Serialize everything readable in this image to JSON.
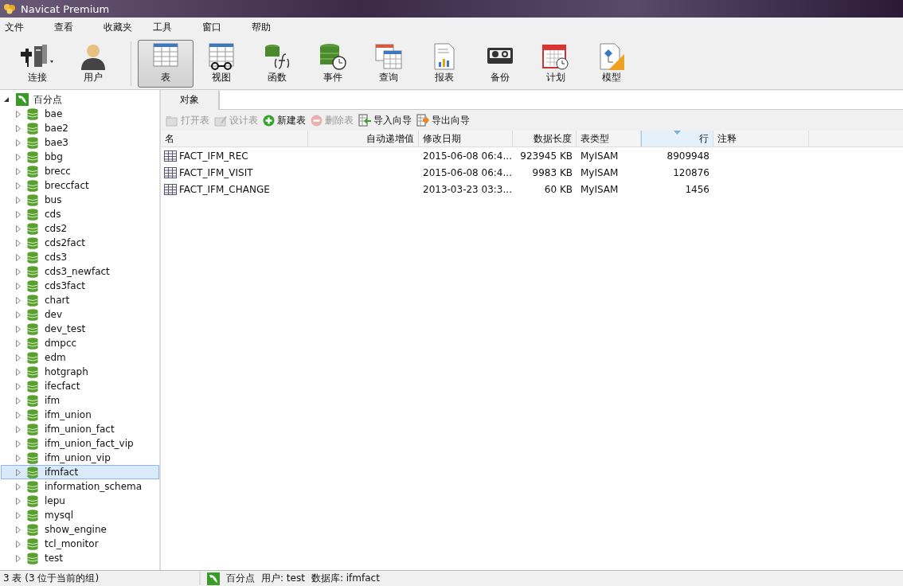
{
  "window": {
    "title": "Navicat Premium"
  },
  "menu": [
    "文件",
    "查看",
    "收藏夹",
    "工具",
    "窗口",
    "帮助"
  ],
  "toolbar": [
    {
      "kind": "connection",
      "label": "连接",
      "selected": false
    },
    {
      "kind": "user",
      "label": "用户",
      "selected": false
    },
    {
      "kind": "table",
      "label": "表",
      "selected": true
    },
    {
      "kind": "view",
      "label": "视图",
      "selected": false
    },
    {
      "kind": "function",
      "label": "函数",
      "selected": false
    },
    {
      "kind": "event",
      "label": "事件",
      "selected": false
    },
    {
      "kind": "query",
      "label": "查询",
      "selected": false
    },
    {
      "kind": "report",
      "label": "报表",
      "selected": false
    },
    {
      "kind": "backup",
      "label": "备份",
      "selected": false
    },
    {
      "kind": "schedule",
      "label": "计划",
      "selected": false
    },
    {
      "kind": "model",
      "label": "模型",
      "selected": false
    }
  ],
  "sidebar": {
    "connection": {
      "name": "百分点",
      "expanded": true,
      "children": [
        {
          "name": "bae",
          "selected": false
        },
        {
          "name": "bae2",
          "selected": false
        },
        {
          "name": "bae3",
          "selected": false
        },
        {
          "name": "bbg",
          "selected": false
        },
        {
          "name": "brecc",
          "selected": false
        },
        {
          "name": "breccfact",
          "selected": false
        },
        {
          "name": "bus",
          "selected": false
        },
        {
          "name": "cds",
          "selected": false
        },
        {
          "name": "cds2",
          "selected": false
        },
        {
          "name": "cds2fact",
          "selected": false
        },
        {
          "name": "cds3",
          "selected": false
        },
        {
          "name": "cds3_newfact",
          "selected": false
        },
        {
          "name": "cds3fact",
          "selected": false
        },
        {
          "name": "chart",
          "selected": false
        },
        {
          "name": "dev",
          "selected": false
        },
        {
          "name": "dev_test",
          "selected": false
        },
        {
          "name": "dmpcc",
          "selected": false
        },
        {
          "name": "edm",
          "selected": false
        },
        {
          "name": "hotgraph",
          "selected": false
        },
        {
          "name": "ifecfact",
          "selected": false
        },
        {
          "name": "ifm",
          "selected": false
        },
        {
          "name": "ifm_union",
          "selected": false
        },
        {
          "name": "ifm_union_fact",
          "selected": false
        },
        {
          "name": "ifm_union_fact_vip",
          "selected": false
        },
        {
          "name": "ifm_union_vip",
          "selected": false
        },
        {
          "name": "ifmfact",
          "selected": true
        },
        {
          "name": "information_schema",
          "selected": false
        },
        {
          "name": "lepu",
          "selected": false
        },
        {
          "name": "mysql",
          "selected": false
        },
        {
          "name": "show_engine",
          "selected": false
        },
        {
          "name": "tcl_monitor",
          "selected": false
        },
        {
          "name": "test",
          "selected": false
        }
      ]
    }
  },
  "tabs": [
    {
      "label": "对象",
      "selected": true
    }
  ],
  "actions": [
    {
      "kind": "open",
      "label": "打开表",
      "disabled": true
    },
    {
      "kind": "design",
      "label": "设计表",
      "disabled": true
    },
    {
      "kind": "new",
      "label": "新建表",
      "disabled": false
    },
    {
      "kind": "delete",
      "label": "删除表",
      "disabled": true
    },
    {
      "kind": "import",
      "label": "导入向导",
      "disabled": false
    },
    {
      "kind": "export",
      "label": "导出向导",
      "disabled": false
    }
  ],
  "table": {
    "columns": [
      {
        "label": "名",
        "sorted": false
      },
      {
        "label": "自动递增值",
        "sorted": false
      },
      {
        "label": "修改日期",
        "sorted": false
      },
      {
        "label": "数据长度",
        "sorted": false
      },
      {
        "label": "表类型",
        "sorted": false
      },
      {
        "label": "行",
        "sorted": true
      },
      {
        "label": "注释",
        "sorted": false
      }
    ],
    "rows": [
      [
        "FACT_IFM_REC",
        "",
        "2015-06-08 06:4...",
        "923945 KB",
        "MyISAM",
        "8909948",
        ""
      ],
      [
        "FACT_IFM_VISIT",
        "",
        "2015-06-08 06:4...",
        "9983 KB",
        "MyISAM",
        "120876",
        ""
      ],
      [
        "FACT_IFM_CHANGE",
        "",
        "2013-03-23 03:3...",
        "60 KB",
        "MyISAM",
        "1456",
        ""
      ]
    ]
  },
  "status_bar": {
    "left": "3 表 (3 位于当前的组)",
    "connection": "百分点",
    "user": "用户: test",
    "database": "数据库: ifmfact"
  }
}
